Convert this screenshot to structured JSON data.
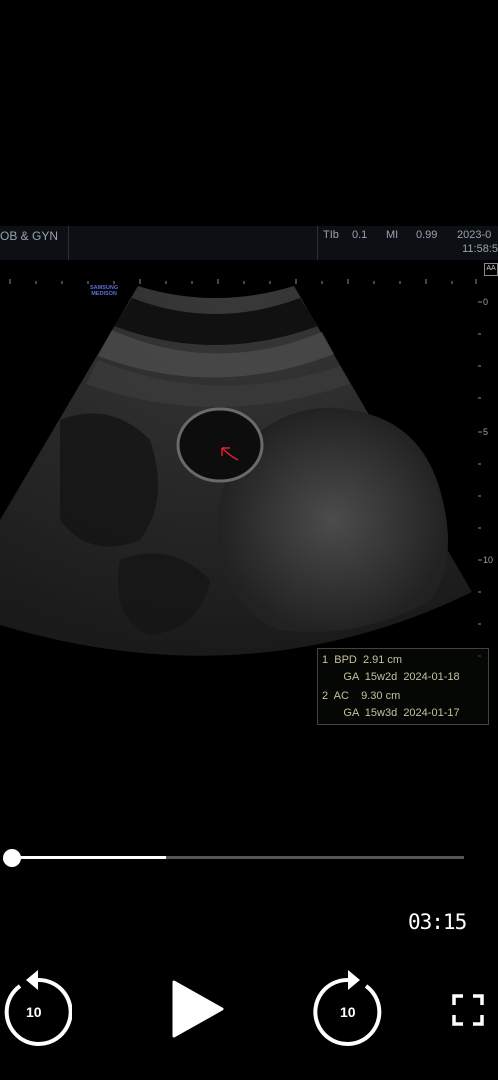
{
  "header": {
    "exam": "OB & GYN",
    "tib_label": "TIb",
    "tib_value": "0.1",
    "mi_label": "MI",
    "mi_value": "0.99",
    "date": "2023-0",
    "time": "11:58:5"
  },
  "overlay": {
    "brand_line1": "SAMSUNG",
    "brand_line2": "MEDISON",
    "mode": "AA",
    "depth_scale": [
      "0",
      "5",
      "10"
    ]
  },
  "measurements": [
    {
      "line1": "1  BPD  2.91 cm",
      "line2": "       GA  15w2d  2024-01-18"
    },
    {
      "line1": "2  AC    9.30 cm",
      "line2": "       GA  15w3d  2024-01-17"
    }
  ],
  "player": {
    "progress_fraction": 0.34,
    "elapsed": "03:15",
    "rewind_seconds": "10",
    "forward_seconds": "10"
  },
  "colors": {
    "background": "#000000",
    "annotation_arrow": "#e0202a",
    "measurement_text": "#c5c09e"
  },
  "icons": [
    "rewind-10-icon",
    "play-icon",
    "forward-10-icon",
    "fullscreen-icon"
  ]
}
